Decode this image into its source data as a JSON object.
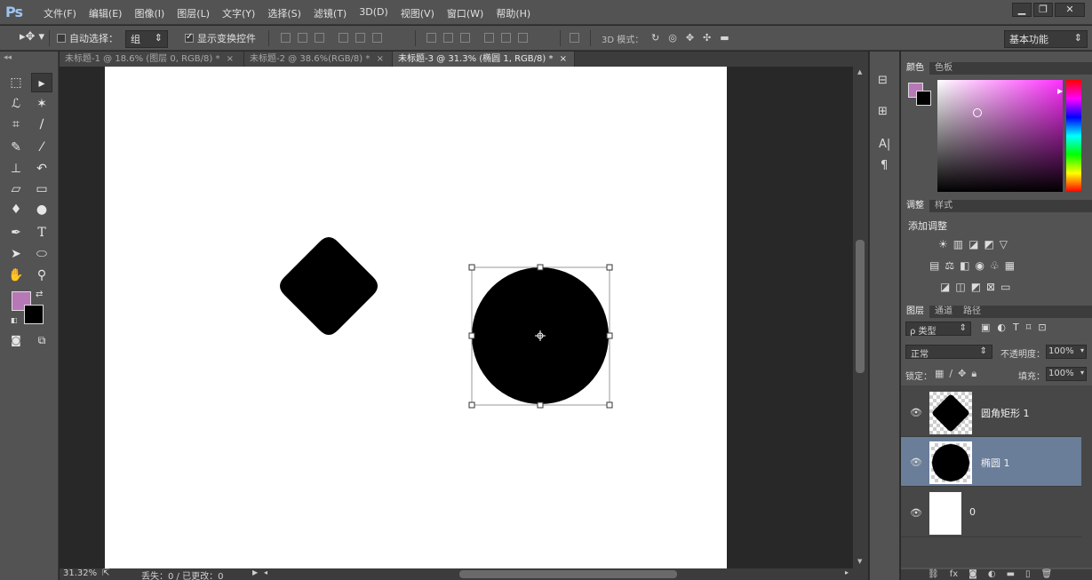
{
  "app": {
    "logo": "Ps"
  },
  "menu": [
    "文件(F)",
    "编辑(E)",
    "图像(I)",
    "图层(L)",
    "文字(Y)",
    "选择(S)",
    "滤镜(T)",
    "3D(D)",
    "视图(V)",
    "窗口(W)",
    "帮助(H)"
  ],
  "window_buttons": {
    "minimize": "▁",
    "restore": "❐",
    "close": "✕"
  },
  "options": {
    "auto_select_label": "自动选择：",
    "auto_select_value": "组",
    "show_transform_label": "显示变换控件",
    "mode_3d_label": "3D 模式：",
    "workspace": "基本功能"
  },
  "tabs": [
    {
      "label": "未标题-1 @ 18.6% (图层 0, RGB/8) *",
      "close": "×"
    },
    {
      "label": "未标题-2 @ 38.6%(RGB/8) *",
      "close": "×"
    },
    {
      "label": "未标题-3 @ 31.3% (椭圆 1, RGB/8) *",
      "close": "×"
    }
  ],
  "status": {
    "zoom": "31.32%",
    "info": "丢失：0 / 已更改：0"
  },
  "color_panel": {
    "tabs": [
      "颜色",
      "色板"
    ],
    "foreground": "#b678b6",
    "background": "#000000"
  },
  "adjust_panel": {
    "tabs": [
      "调整",
      "样式"
    ],
    "title": "添加调整"
  },
  "layers_panel": {
    "tabs": [
      "图层",
      "通道",
      "路径"
    ],
    "filter_label": "ρ 类型",
    "blend_mode": "正常",
    "opacity_label": "不透明度：",
    "opacity_value": "100%",
    "lock_label": "锁定：",
    "fill_label": "填充：",
    "fill_value": "100%",
    "layers": [
      {
        "name": "圆角矩形 1",
        "selected": false
      },
      {
        "name": "椭圆 1",
        "selected": true
      },
      {
        "name": "0",
        "selected": false
      }
    ]
  },
  "strip_labels": {
    "text_tool": "A|",
    "paragraph": "¶"
  }
}
